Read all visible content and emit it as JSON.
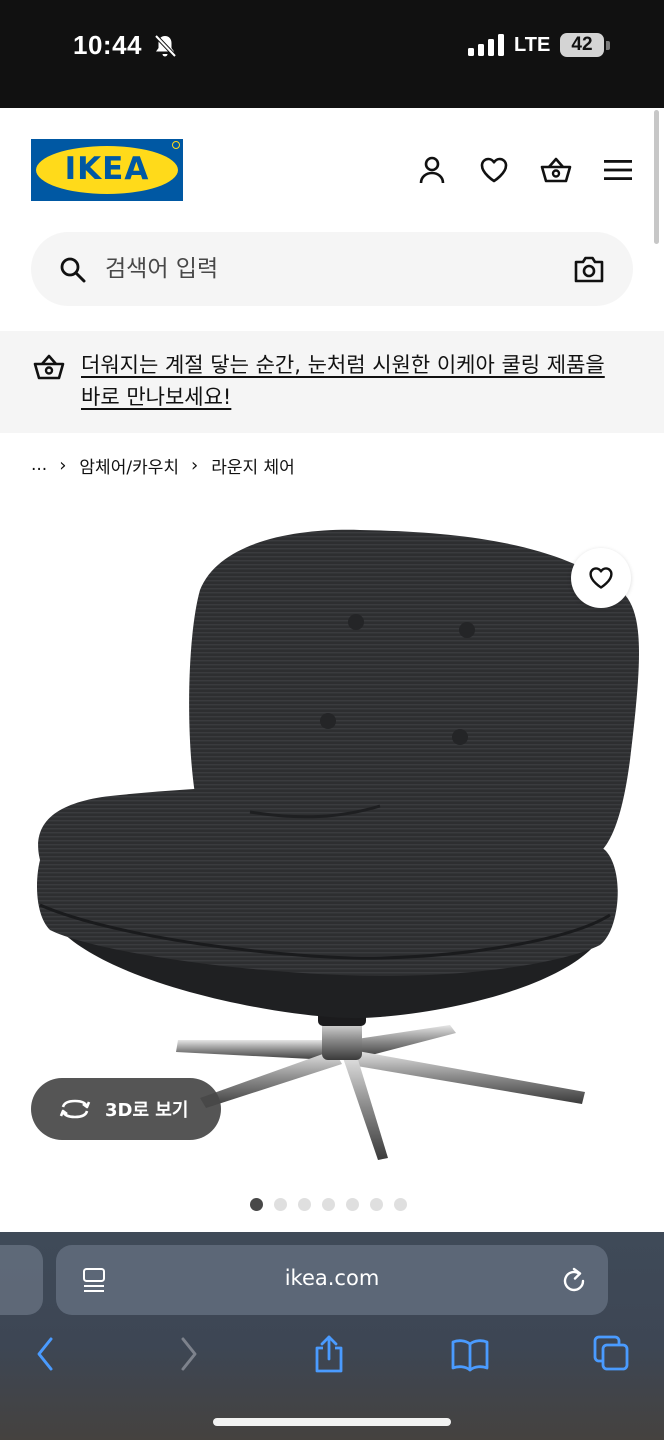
{
  "status_bar": {
    "time": "10:44",
    "network": "LTE",
    "battery": "42",
    "icons": [
      "bell-muted-icon",
      "signal-icon",
      "battery-icon"
    ]
  },
  "header": {
    "logo_text": "IKEA",
    "brand_colors": {
      "blue": "#0058a3",
      "yellow": "#ffda1a"
    },
    "icons": [
      "user-icon",
      "heart-icon",
      "basket-icon",
      "menu-icon"
    ]
  },
  "search": {
    "placeholder": "검색어 입력",
    "icons": [
      "search-icon",
      "camera-icon"
    ]
  },
  "promo": {
    "text": "더워지는 계절 닿는 순간, 눈처럼 시원한 이케아 쿨링 제품을 바로 만나보세요!",
    "icon": "basket-icon"
  },
  "breadcrumb": {
    "items": [
      "...",
      "암체어/카우치",
      "라운지 체어"
    ],
    "separator": "›"
  },
  "product": {
    "image": "dark gray corduroy swivel lounge chair with chrome star base",
    "view_3d_label": "3D로 보기",
    "image_count": 7,
    "active_image": 1
  },
  "browser": {
    "url": "ikea.com",
    "icons": [
      "tabs-menu-icon",
      "reload-icon",
      "back-icon",
      "forward-icon",
      "share-icon",
      "bookmarks-icon",
      "tabs-icon"
    ]
  }
}
